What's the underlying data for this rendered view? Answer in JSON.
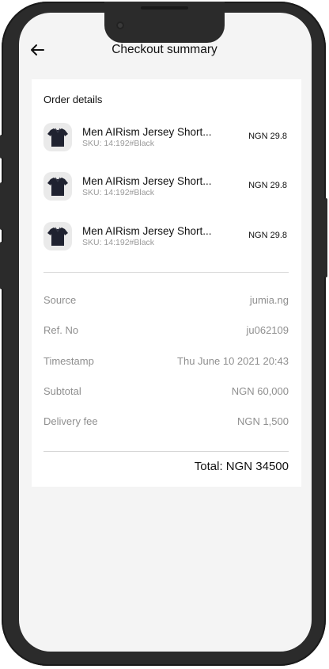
{
  "header": {
    "title": "Checkout summary",
    "back_icon": "arrow-left-icon"
  },
  "order": {
    "section_title": "Order details",
    "items": [
      {
        "name": "Men AIRism Jersey Short...",
        "sku": "SKU: 14:192#Black",
        "price": "NGN 29.8"
      },
      {
        "name": "Men AIRism Jersey Short...",
        "sku": "SKU: 14:192#Black",
        "price": "NGN 29.8"
      },
      {
        "name": "Men AIRism Jersey Short...",
        "sku": "SKU: 14:192#Black",
        "price": "NGN 29.8"
      }
    ]
  },
  "summary": {
    "rows": [
      {
        "label": "Source",
        "value": "jumia.ng"
      },
      {
        "label": "Ref. No",
        "value": "ju062109"
      },
      {
        "label": "Timestamp",
        "value": "Thu June 10 2021 20:43"
      },
      {
        "label": "Subtotal",
        "value": "NGN 60,000"
      },
      {
        "label": "Delivery fee",
        "value": "NGN 1,500"
      }
    ],
    "total": "Total: NGN 34500"
  },
  "colors": {
    "frame": "#2b2b2b",
    "screen_bg": "#f4f4f4",
    "card_bg": "#ffffff",
    "muted_text": "#8f8f8f"
  }
}
